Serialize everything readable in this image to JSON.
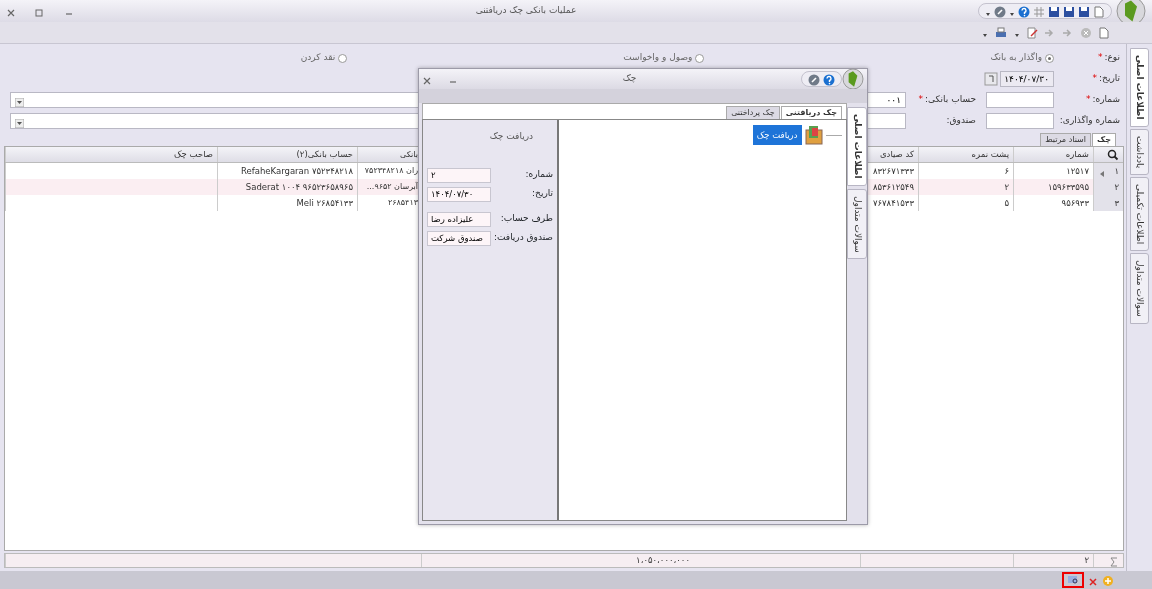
{
  "window": {
    "title": "عملیات بانکی چک دریافتنی"
  },
  "side_tabs": [
    {
      "label": "اطلاعات اصلی",
      "selected": true
    },
    {
      "label": "یادداشت",
      "selected": false
    },
    {
      "label": "اطلاعات تکمیلی",
      "selected": false
    },
    {
      "label": "سوالات متداول",
      "selected": false
    }
  ],
  "form": {
    "type_label": "نوع:",
    "type_required_mark": "*",
    "type_options": [
      {
        "label": "واگذار به بانک",
        "selected": true
      },
      {
        "label": "وصول و واخواست",
        "selected": false
      },
      {
        "label": "نقد کردن",
        "selected": false
      }
    ],
    "date": {
      "label": "تاریخ:",
      "required_mark": "*",
      "value": "۱۴۰۴/۰۷/۳۰"
    },
    "number": {
      "label": "شماره:",
      "required_mark": "*"
    },
    "bank_account": {
      "label": "حساب بانکی:",
      "required_mark": "*",
      "value": "۰۰۱"
    },
    "assignment_number": {
      "label": "شماره واگذاری:"
    },
    "fund": {
      "label": "صندوق:"
    }
  },
  "grid_tabs": [
    {
      "label": "چک",
      "selected": true
    },
    {
      "label": "اسناد مرتبط",
      "selected": false
    }
  ],
  "table": {
    "columns": [
      "شماره",
      "پشت نمره",
      "کد صیادی",
      "بانکی",
      "حساب بانکی(۲)",
      "صاحب چک"
    ],
    "rows": [
      {
        "index": "۱",
        "current": true,
        "cells": [
          "۱۲۵۱۷",
          "۶",
          "۸۳۲۶۷۱۳۳۳",
          "ران  ۷۵۲۳۴۸۲۱۸",
          "RefaheKargaran  ۷۵۲۳۴۸۲۱۸",
          ""
        ]
      },
      {
        "index": "۲",
        "current": false,
        "cells": [
          "۱۵۹۶۳۳۵۹۵",
          "۲",
          "۸۵۳۶۱۲۵۴۹",
          "آبرسان  ۹۶۵۲...",
          "Saderat ۱۰۰۴  ۹۶۵۲۳۶۵۸۹۶۵",
          ""
        ]
      },
      {
        "index": "۳",
        "current": false,
        "cells": [
          "۹۵۶۹۳۳",
          "۵",
          "۷۶۷۸۴۱۵۳۳",
          "۲۶۸۵۴۱۳",
          "Meli  ۲۶۸۵۴۱۳۳",
          ""
        ]
      }
    ],
    "totals": {
      "count": "۲",
      "amount": "۱،۰۵۰،۰۰۰،۰۰۰"
    }
  },
  "dialog": {
    "title": "چک",
    "tabs": [
      {
        "label": "چک دریافتنی",
        "selected": true
      },
      {
        "label": "چک پرداختنی",
        "selected": false
      }
    ],
    "panel_title": "دریافت چک",
    "fields": [
      {
        "label": "شماره:",
        "value": "۲"
      },
      {
        "label": "تاریخ:",
        "value": "۱۴۰۴/۰۷/۳۰"
      },
      {
        "label": "طرف حساب:",
        "value": "علیزاده رضا"
      },
      {
        "label": "صندوق دریافت:",
        "value": "صندوق شرکت"
      }
    ],
    "nodes": [
      {
        "label": "دریافت چک",
        "selected": true
      }
    ],
    "side_tabs": [
      {
        "label": "اطلاعات اصلی",
        "selected": true
      },
      {
        "label": "سوالات متداول",
        "selected": false
      }
    ]
  }
}
